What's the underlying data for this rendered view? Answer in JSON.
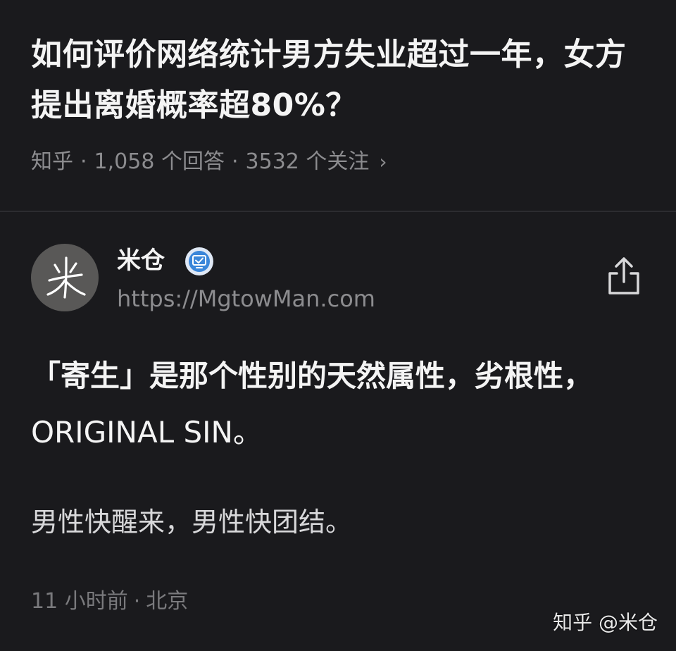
{
  "question": {
    "title": "如何评价网络统计男方失业超过一年，女方提出离婚概率超80%？",
    "source": "知乎",
    "separator": "·",
    "answers": "1,058 个回答",
    "followers": "3532 个关注",
    "chevron": "›"
  },
  "author": {
    "avatar_glyph": "米",
    "name": "米仓",
    "bio": "https://MgtowMan.com",
    "badge_icon": "verified-badge-icon"
  },
  "answer": {
    "line1": "「寄生」是那个性别的天然属性，劣根性，",
    "line2": "ORIGINAL SIN。",
    "paragraph2": "男性快醒来，男性快团结。",
    "time": "11 小时前",
    "separator": "·",
    "location": "北京"
  },
  "watermark": "知乎 @米仓",
  "colors": {
    "background": "#1a1a1d",
    "primary_text": "#f4f4f4",
    "secondary_text": "#8c8c8f",
    "divider": "#2c2c30",
    "badge": "#3a86d9"
  }
}
